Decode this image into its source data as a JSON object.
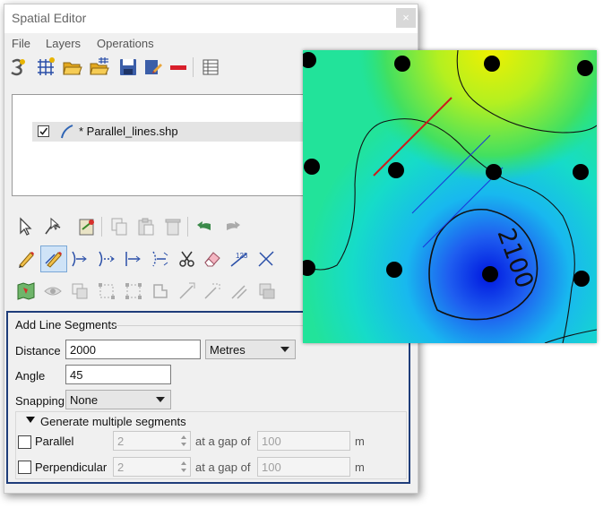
{
  "window": {
    "title": "Spatial Editor",
    "close": "×"
  },
  "menu": [
    "File",
    "Layers",
    "Operations"
  ],
  "layers": {
    "items": [
      {
        "name": "* Parallel_lines.shp",
        "checked": true
      }
    ]
  },
  "map": {
    "contour_label": "2100"
  },
  "panel": {
    "title": "Add Line Segments",
    "distance_label": "Distance",
    "distance_value": "2000",
    "units_value": "Metres",
    "angle_label": "Angle",
    "angle_value": "45",
    "snapping_label": "Snapping",
    "snapping_value": "None",
    "multiple_label": "Generate multiple segments",
    "parallel_label": "Parallel",
    "parallel_count": "2",
    "gap_label": "at a gap of",
    "parallel_gap": "100",
    "unit_m": "m",
    "perpendicular_label": "Perpendicular",
    "perpendicular_count": "2",
    "perpendicular_gap": "100"
  }
}
